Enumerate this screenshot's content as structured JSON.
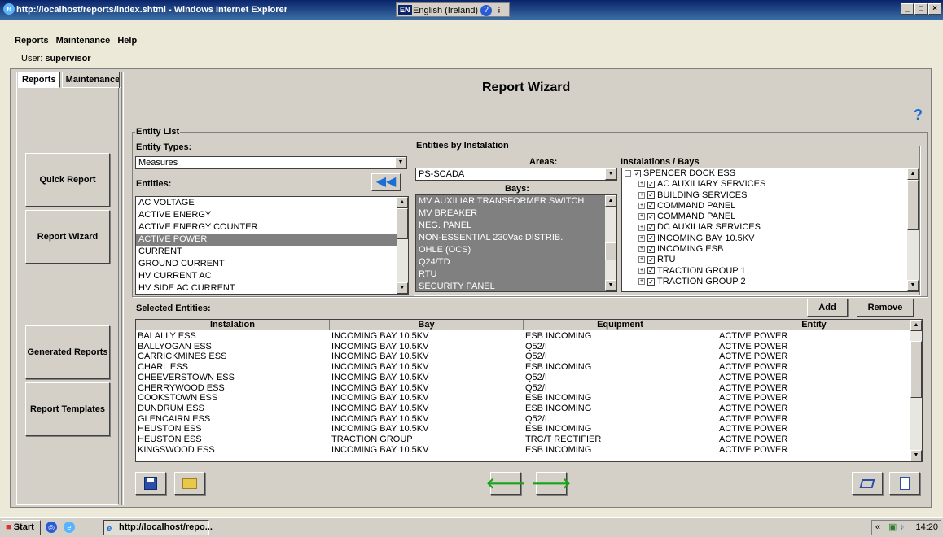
{
  "window": {
    "title": "http://localhost/reports/index.shtml - Windows Internet Explorer",
    "lang_code": "EN",
    "lang_label": "English (Ireland)",
    "controls": [
      "_",
      "□",
      "×"
    ]
  },
  "menu": [
    "Reports",
    "Maintenance",
    "Help"
  ],
  "user": {
    "label": "User:",
    "name": "supervisor"
  },
  "tabs": [
    "Reports",
    "Maintenance"
  ],
  "nav": {
    "quick_report": "Quick Report",
    "report_wizard": "Report Wizard",
    "generated_reports": "Generated Reports",
    "report_templates": "Report Templates"
  },
  "page_title": "Report Wizard",
  "help_icon": "?",
  "entity_list": {
    "legend": "Entity List",
    "types_label": "Entity Types:",
    "types_value": "Measures",
    "entities_label": "Entities:",
    "entities": [
      "AC VOLTAGE",
      "ACTIVE ENERGY",
      "ACTIVE ENERGY COUNTER",
      "ACTIVE POWER",
      "CURRENT",
      "GROUND CURRENT",
      "HV CURRENT AC",
      "HV SIDE AC CURRENT"
    ],
    "selected_index": 3
  },
  "by_installation": {
    "legend": "Entities by Instalation",
    "areas_label": "Areas:",
    "areas_value": "PS-SCADA",
    "bays_label": "Bays:",
    "bays": [
      "MV AUXILIAR TRANSFORMER SWITCH",
      "MV BREAKER",
      "NEG. PANEL",
      "NON-ESSENTIAL 230Vac DISTRIB.",
      "OHLE (OCS)",
      "Q24/TD",
      "RTU",
      "SECURITY PANEL"
    ],
    "installations_label": "Instalations / Bays",
    "tree_root": "SPENCER DOCK ESS",
    "tree_children": [
      "AC AUXILIARY SERVICES",
      "BUILDING SERVICES",
      "COMMAND PANEL",
      "COMMAND PANEL",
      "DC AUXILIAR SERVICES",
      "INCOMING BAY 10.5KV",
      "INCOMING ESB",
      "RTU",
      "TRACTION GROUP 1",
      "TRACTION GROUP 2"
    ]
  },
  "selected": {
    "label": "Selected Entities:",
    "add": "Add",
    "remove": "Remove",
    "columns": [
      "Instalation",
      "Bay",
      "Equipment",
      "Entity"
    ],
    "rows": [
      [
        "BALALLY ESS",
        "INCOMING BAY 10.5KV",
        "ESB INCOMING",
        "ACTIVE POWER"
      ],
      [
        "BALLYOGAN ESS",
        "INCOMING BAY 10.5KV",
        "Q52/I",
        "ACTIVE POWER"
      ],
      [
        "CARRICKMINES ESS",
        "INCOMING BAY 10.5KV",
        "Q52/I",
        "ACTIVE POWER"
      ],
      [
        "CHARL ESS",
        "INCOMING BAY 10.5KV",
        "ESB INCOMING",
        "ACTIVE POWER"
      ],
      [
        "CHEEVERSTOWN ESS",
        "INCOMING BAY 10.5KV",
        "Q52/I",
        "ACTIVE POWER"
      ],
      [
        "CHERRYWOOD ESS",
        "INCOMING BAY 10.5KV",
        "Q52/I",
        "ACTIVE POWER"
      ],
      [
        "COOKSTOWN ESS",
        "INCOMING BAY 10.5KV",
        "ESB INCOMING",
        "ACTIVE POWER"
      ],
      [
        "DUNDRUM ESS",
        "INCOMING BAY 10.5KV",
        "ESB INCOMING",
        "ACTIVE POWER"
      ],
      [
        "GLENCAIRN ESS",
        "INCOMING BAY 10.5KV",
        "Q52/I",
        "ACTIVE POWER"
      ],
      [
        "HEUSTON ESS",
        "INCOMING BAY 10.5KV",
        "ESB INCOMING",
        "ACTIVE POWER"
      ],
      [
        "HEUSTON ESS",
        "TRACTION GROUP",
        "TRC/T RECTIFIER",
        "ACTIVE POWER"
      ],
      [
        "KINGSWOOD ESS",
        "INCOMING BAY 10.5KV",
        "ESB INCOMING",
        "ACTIVE POWER"
      ]
    ]
  },
  "taskbar": {
    "start": "Start",
    "item": "http://localhost/repo...",
    "tray_arrows": "«",
    "time": "14:20"
  }
}
